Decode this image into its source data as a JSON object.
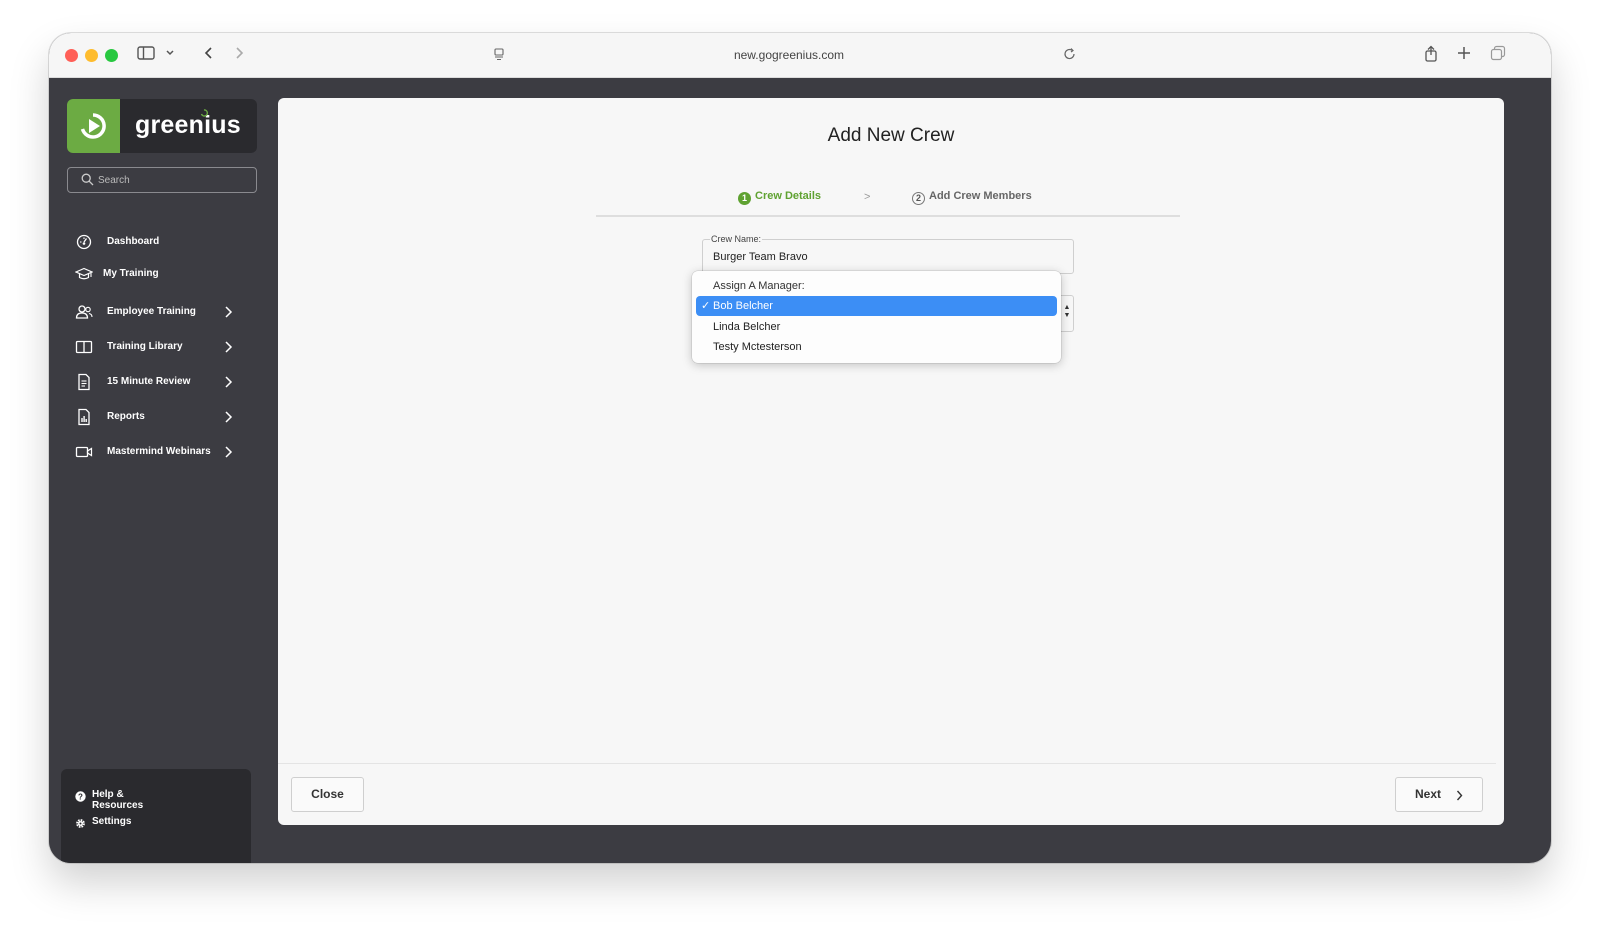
{
  "browser": {
    "url": "new.gogreenius.com"
  },
  "sidebar": {
    "logo_text": "greenius",
    "search_placeholder": "Search",
    "nav_items": [
      {
        "label": "Dashboard",
        "icon": "dashboard-icon",
        "has_chevron": false
      },
      {
        "label": "My Training",
        "icon": "graduation-cap-icon",
        "has_chevron": false
      },
      {
        "label": "Employee Training",
        "icon": "users-icon",
        "has_chevron": true
      },
      {
        "label": "Training Library",
        "icon": "book-icon",
        "has_chevron": true
      },
      {
        "label": "15 Minute Review",
        "icon": "document-icon",
        "has_chevron": true
      },
      {
        "label": "Reports",
        "icon": "report-icon",
        "has_chevron": true
      },
      {
        "label": "Mastermind Webinars",
        "icon": "video-camera-icon",
        "has_chevron": true
      }
    ],
    "bottom_items": [
      {
        "label": "Help & Resources",
        "icon": "help-icon"
      },
      {
        "label": "Settings",
        "icon": "gear-icon"
      }
    ]
  },
  "modal": {
    "title": "Add New Crew",
    "steps": [
      {
        "number": "1",
        "label": "Crew Details",
        "active": true
      },
      {
        "number": "2",
        "label": "Add Crew Members",
        "active": false
      }
    ],
    "step_separator": ">",
    "crew_name": {
      "label": "Crew Name:",
      "value": "Burger Team Bravo"
    },
    "manager_dropdown": {
      "header": "Assign A Manager:",
      "options": [
        "Bob Belcher",
        "Linda Belcher",
        "Testy Mctesterson"
      ],
      "selected": "Bob Belcher",
      "check_mark": "✓"
    },
    "close_label": "Close",
    "next_label": "Next"
  },
  "colors": {
    "brand_green": "#6cab43",
    "active_step": "#5fa231",
    "selection_blue": "#3c8ef5",
    "sidebar_bg": "#3c3c42"
  }
}
